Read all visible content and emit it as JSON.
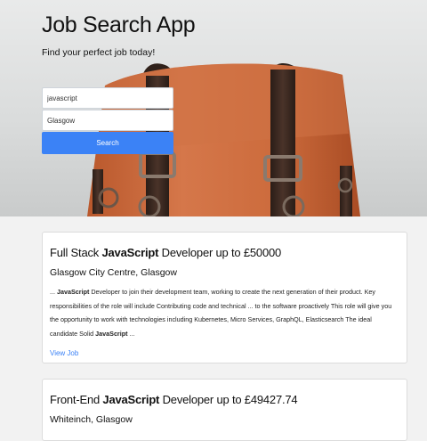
{
  "header": {
    "title": "Job Search App",
    "subtitle": "Find your perfect job today!"
  },
  "search": {
    "keyword_value": "javascript",
    "location_value": "Glasgow",
    "button_label": "Search"
  },
  "jobs": [
    {
      "title_pre": "Full Stack ",
      "title_bold": "JavaScript",
      "title_post": " Developer up to £50000",
      "location": "Glasgow City Centre, Glasgow",
      "snippet_1": "... ",
      "snippet_bold_1": "JavaScript",
      "snippet_2": " Developer to join their development team, working to create the next generation of their product. Key responsibilities of the role will include Contributing code and technical ... to the software proactively This role will give you the opportunity to work with technologies including Kubernetes, Micro Services, GraphQL, Elasticsearch The ideal candidate Solid ",
      "snippet_bold_2": "JavaScript",
      "snippet_3": " ...",
      "link_label": "View Job"
    },
    {
      "title_pre": "Front-End ",
      "title_bold": "JavaScript",
      "title_post": " Developer up to £49427.74",
      "location": "Whiteinch, Glasgow"
    }
  ],
  "colors": {
    "accent": "#3b82f6",
    "leather": "#c8693b",
    "strap": "#3a2a22"
  }
}
